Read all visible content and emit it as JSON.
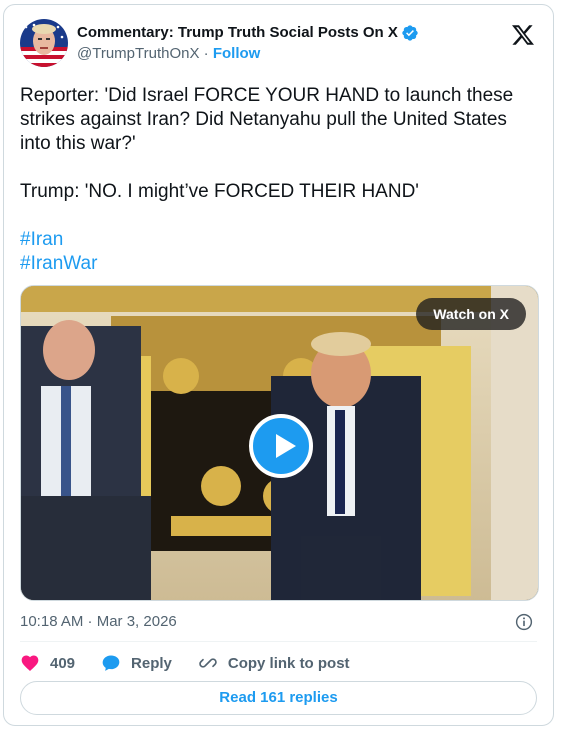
{
  "author": {
    "display_name": "Commentary: Trump Truth Social Posts On X",
    "handle": "@TrumpTruthOnX",
    "separator": "·",
    "follow_label": "Follow"
  },
  "post": {
    "line1": "Reporter: 'Did Israel FORCE YOUR HAND to launch these strikes against Iran? Did Netanyahu pull the United States into this war?'",
    "line2": "Trump: 'NO. I might’ve FORCED THEIR HAND'",
    "hashtags": [
      "#Iran",
      "#IranWar"
    ]
  },
  "media": {
    "watch_label": "Watch on X"
  },
  "meta": {
    "timestamp": "10:18 AM · Mar 3, 2026"
  },
  "actions": {
    "likes": "409",
    "reply_label": "Reply",
    "copy_label": "Copy link to post"
  },
  "footer": {
    "read_replies_label": "Read 161 replies"
  },
  "colors": {
    "accent": "#1d9bf0",
    "like": "#f91880",
    "muted": "#536471"
  }
}
